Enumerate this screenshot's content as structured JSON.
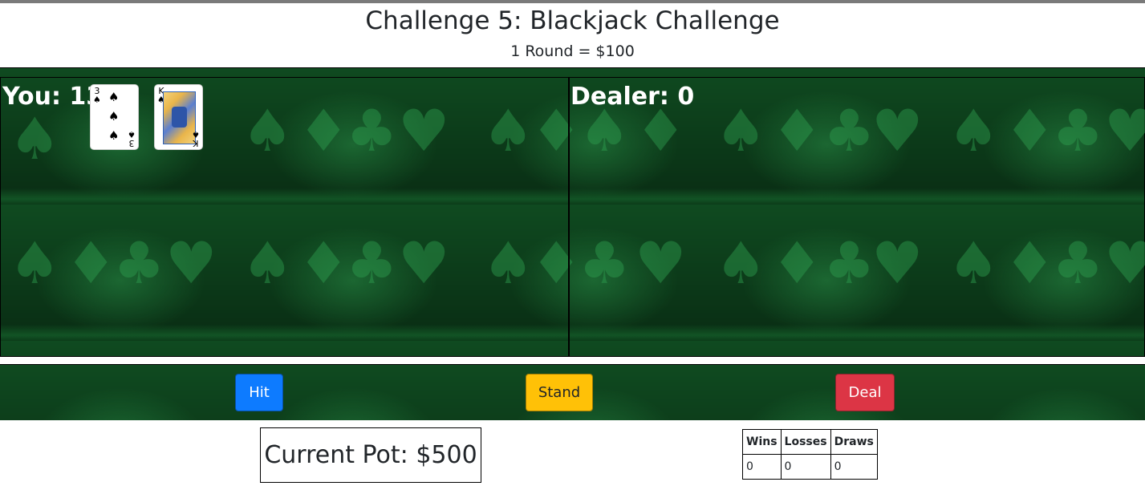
{
  "header": {
    "title": "Challenge 5: Blackjack Challenge",
    "subtitle": "1 Round = $100"
  },
  "player": {
    "label": "You: 13",
    "cards": [
      {
        "rank": "3",
        "suit": "♠"
      },
      {
        "rank": "K",
        "suit": "♠"
      }
    ]
  },
  "dealer": {
    "label": "Dealer: 0"
  },
  "controls": {
    "hit_label": "Hit",
    "stand_label": "Stand",
    "deal_label": "Deal",
    "colors": {
      "hit": "#0d7bff",
      "stand": "#ffc107",
      "deal": "#dc3545"
    }
  },
  "pot": {
    "label": "Current Pot: $500"
  },
  "stats": {
    "headers": [
      "Wins",
      "Losses",
      "Draws"
    ],
    "values": [
      "0",
      "0",
      "0"
    ]
  },
  "theme": {
    "felt_color": "#0f4a20"
  }
}
